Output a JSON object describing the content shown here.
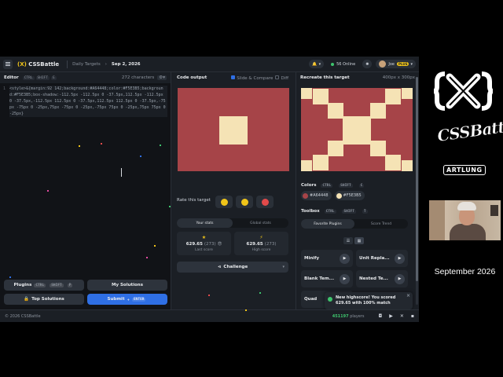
{
  "topbar": {
    "logo_x": "(X)",
    "logo_name": "CSSBattle",
    "crumb_daily": "Daily Targets",
    "crumb_date": "Sep 2, 2026",
    "online_count": "56",
    "online_label": "Online",
    "user_name": "Joe",
    "plus_badge": "PLUS"
  },
  "editor": {
    "title": "Editor",
    "shortcut": [
      "CTRL",
      "SHIFT",
      "E"
    ],
    "char_count": "272 characters",
    "line_number": "1",
    "code": "<style>&{margin:92 142;background:#A64448;color:#F5E3B5;background:#F5E3B5;box-shadow:-112.5px -112.5px 0 -37.5px,112.5px -112.5px 0 -37.5px,-112.5px 112.5px 0 -37.5px,112.5px 112.5px 0 -37.5px,-75px -75px 0 -25px,75px -75px 0 -25px,-75px 75px 0 -25px,75px 75px 0 -25px}",
    "plugins_label": "Plugins",
    "plugins_shortcut": [
      "CTRL",
      "SHIFT",
      "P"
    ],
    "my_solutions_label": "My Solutions",
    "top_solutions_label": "Top Solutions",
    "submit_label": "Submit",
    "submit_shortcut": "ENTER"
  },
  "output": {
    "title": "Code output",
    "slide_compare": "Slide & Compare",
    "diff": "Diff",
    "rate_label": "Rate this target",
    "tab_your_stats": "Your stats",
    "tab_global_stats": "Global stats",
    "last_score": "629.65",
    "last_chars": "(273)",
    "last_label": "Last score",
    "high_score": "629.65",
    "high_chars": "(273)",
    "high_label": "High score",
    "challenge_label": "Challenge"
  },
  "target": {
    "title": "Recreate this target",
    "size": "400px x 300px",
    "colors_label": "Colors",
    "colors_shortcut": [
      "CTRL",
      "SHIFT",
      "C"
    ],
    "colors": [
      {
        "hex": "#A64448"
      },
      {
        "hex": "#F5E3B5"
      }
    ],
    "toolbox_label": "Toolbox",
    "toolbox_shortcut": [
      "CTRL",
      "SHIFT",
      "T"
    ],
    "tab_favorite_plugins": "Favorite Plugins",
    "tab_score_trend": "Score Trend",
    "plugins": [
      "Minify",
      "Unit Repla...",
      "Blank Tem...",
      "Nested Te...",
      "Quad"
    ],
    "toast_text": "New highscore! You scored 629.65 with 100% match"
  },
  "footer": {
    "copyright": "© 2026 CSSBattle",
    "players_count": "451197",
    "players_label": "players"
  },
  "brand": {
    "logo_text": "{X}",
    "wordmark": "CSSBattle",
    "badge": "ARTLUNG",
    "month": "September 2026"
  },
  "colors": {
    "accent_blue": "#2f6fe4",
    "brand_yellow": "#f0c419",
    "target_bg": "#A64448",
    "target_fg": "#F5E3B5",
    "online_green": "#3ec46d"
  }
}
